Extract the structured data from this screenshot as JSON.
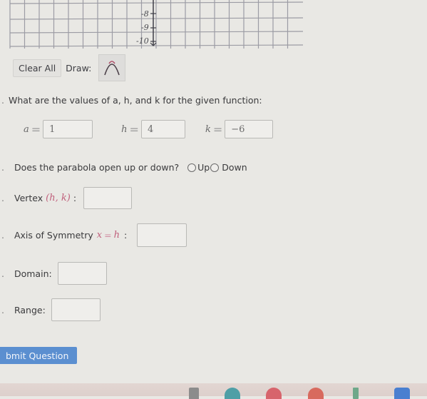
{
  "graph": {
    "y_axis_labels": [
      "-8",
      "-9",
      "-10"
    ]
  },
  "toolbar": {
    "clear_all_label": "Clear All",
    "draw_label": "Draw:",
    "draw_tool_icon": "parabola-down-icon"
  },
  "question_values": {
    "prompt": "What are the values of a, h, and k for the given function:",
    "a": {
      "label": "a",
      "value": "1"
    },
    "h": {
      "label": "h",
      "value": "4"
    },
    "k": {
      "label": "k",
      "value": "−6"
    }
  },
  "question_direction": {
    "prompt": "Does the parabola open up or down?",
    "options": [
      "Up",
      "Down"
    ]
  },
  "question_vertex": {
    "prompt": "Vertex",
    "math": "(h, k)",
    "value": ""
  },
  "question_axis": {
    "prompt": "Axis of Symmetry",
    "math_lhs": "x",
    "math_rhs": "h",
    "value": ""
  },
  "question_domain": {
    "prompt": "Domain:",
    "value": ""
  },
  "question_range": {
    "prompt": "Range:",
    "value": ""
  },
  "submit": {
    "label": "bmit Question"
  },
  "taskbar": {
    "icons": [
      "files-icon",
      "browser-icon",
      "app-icon-red",
      "chrome-icon",
      "app-icon-green",
      "app-icon-blue"
    ]
  }
}
